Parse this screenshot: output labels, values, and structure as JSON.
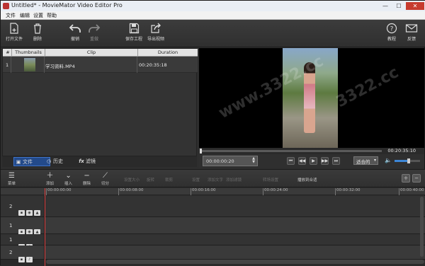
{
  "window": {
    "title": "Untitled* - MovieMator Video Editor Pro",
    "minimize": "—",
    "maximize": "☐",
    "close": "✕"
  },
  "menu": [
    "文件",
    "编辑",
    "设置",
    "帮助"
  ],
  "toolbar": {
    "open": "打开文件",
    "delete": "删除",
    "undo": "撤销",
    "redo": "重做",
    "save": "保存工程",
    "export": "导出视频",
    "tutorial": "教程",
    "feedback": "反馈"
  },
  "clips": {
    "headers": [
      "#",
      "Thumbnails",
      "Clip",
      "Duration"
    ],
    "rows": [
      {
        "index": "1",
        "name": "学习资料.MP4",
        "duration": "00:20:35:18"
      }
    ]
  },
  "left_tabs": [
    {
      "icon": "▣",
      "label": "文件"
    },
    {
      "icon": "◷",
      "label": "历史"
    },
    {
      "icon": "fx",
      "label": "滤镜"
    }
  ],
  "preview": {
    "total_time": "00:20:35:10",
    "current_time": "00:00:00:20",
    "fit": "适合的",
    "volume_level": 0.55
  },
  "timeline_toolbar": {
    "menu": "菜单",
    "add": "添加",
    "insert": "插入",
    "remove": "删除",
    "split": "切分",
    "disabled": [
      "设置大小",
      "旋转",
      "裁剪",
      "设置",
      "添加文字",
      "添加滤镜",
      "转场设置"
    ],
    "snap": "播放到合适"
  },
  "ruler": [
    "00:00:00:00",
    "00:00:08:00",
    "00:00:16:00",
    "00:00:24:00",
    "00:00:32:00",
    "00:00:40:00"
  ],
  "tracks": [
    {
      "number": "2"
    },
    {
      "number": "1"
    },
    {
      "number": "1"
    },
    {
      "number": "2"
    }
  ],
  "watermark": [
    "www.3322.cc",
    "3322.cc"
  ]
}
